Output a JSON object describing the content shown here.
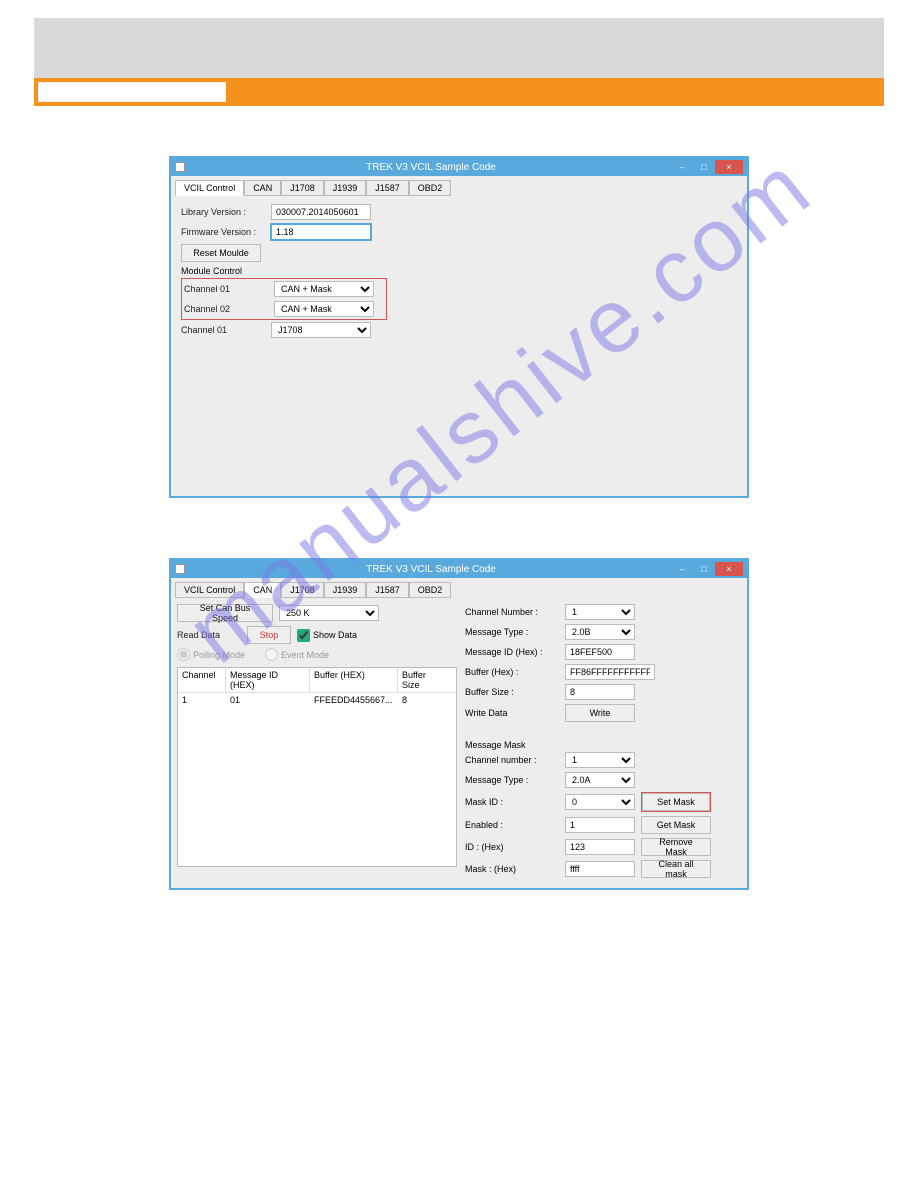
{
  "watermark": "manualshive.com",
  "window1": {
    "title": "TREK V3 VCIL Sample Code",
    "tabs": [
      "VCIL Control",
      "CAN",
      "J1708",
      "J1939",
      "J1587",
      "OBD2"
    ],
    "active_tab": 0,
    "lib_version_label": "Library Version :",
    "lib_version_value": "030007.2014050601",
    "fw_version_label": "Firmware Version :",
    "fw_version_value": "1.18",
    "reset_btn": "Reset Moulde",
    "module_control_label": "Module Control",
    "ch01_label": "Channel 01",
    "ch01_value": "CAN + Mask",
    "ch02_label": "Channel 02",
    "ch02_value": "CAN + Mask",
    "ch01b_label": "Channel 01",
    "ch01b_value": "J1708",
    "minimize": "–",
    "maximize": "□",
    "close": "×"
  },
  "window2": {
    "title": "TREK V3 VCIL Sample Code",
    "tabs": [
      "VCIL Control",
      "CAN",
      "J1708",
      "J1939",
      "J1587",
      "OBD2"
    ],
    "active_tab": 1,
    "set_speed_btn": "Set Can Bus Speed",
    "speed_value": "250 K",
    "read_data_label": "Read Data",
    "stop_btn": "Stop",
    "show_data_label": "Show Data",
    "polling_label": "Polling Mode",
    "event_label": "Event Mode",
    "lv_cols": [
      "Channel",
      "Message ID (HEX)",
      "Buffer (HEX)",
      "Buffer Size"
    ],
    "lv_row": {
      "channel": "1",
      "msgid": "01",
      "buffer": "FFEEDD4455667...",
      "size": "8"
    },
    "right": {
      "ch_num_label": "Channel Number :",
      "ch_num_value": "1",
      "msg_type_label": "Message Type :",
      "msg_type_value": "2.0B",
      "msg_id_label": "Message ID (Hex) :",
      "msg_id_value": "18FEF500",
      "buffer_label": "Buffer (Hex) :",
      "buffer_value": "FF86FFFFFFFFFFFF",
      "buffer_size_label": "Buffer Size :",
      "buffer_size_value": "8",
      "write_data_label": "Write Data",
      "write_btn": "Write",
      "mask_section": "Message Mask",
      "m_ch_label": "Channel number :",
      "m_ch_value": "1",
      "m_type_label": "Message Type :",
      "m_type_value": "2.0A",
      "mask_id_label": "Mask ID :",
      "mask_id_value": "0",
      "set_mask_btn": "Set Mask",
      "enabled_label": "Enabled :",
      "enabled_value": "1",
      "get_mask_btn": "Get Mask",
      "id_hex_label": "ID : (Hex)",
      "id_hex_value": "123",
      "remove_mask_btn": "Remove Mask",
      "mask_hex_label": "Mask : (Hex)",
      "mask_hex_value": "ffff",
      "clean_all_btn": "Clean all mask"
    },
    "minimize": "–",
    "maximize": "□",
    "close": "×"
  }
}
